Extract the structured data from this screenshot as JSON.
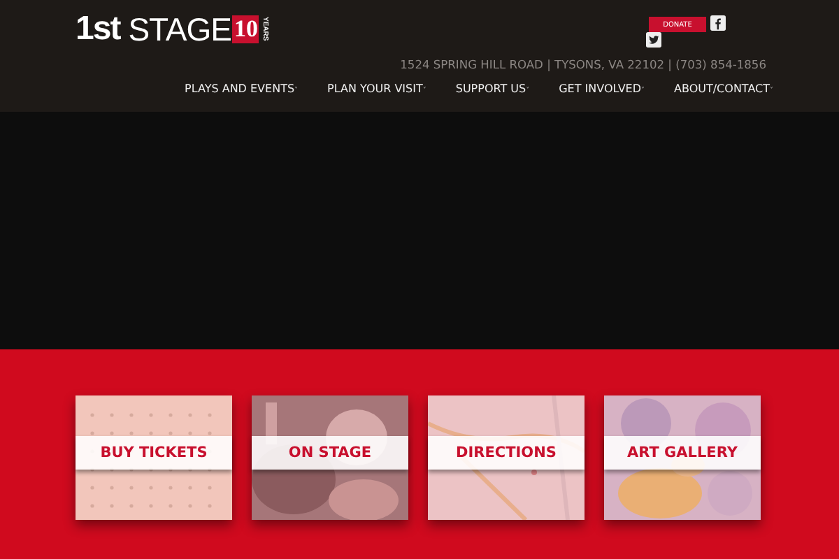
{
  "logo": {
    "word_1": "1st",
    "word_2": "STAGE",
    "badge_number": "10",
    "badge_caption": "YEARS"
  },
  "donate_button": "DONATE",
  "address": "1524 SPRING HILL ROAD | TYSONS, VA 22102 | (703) 854-1856",
  "nav": [
    {
      "label": "PLAYS AND EVENTS",
      "caret": "˅"
    },
    {
      "label": "PLAN YOUR VISIT",
      "caret": "˅"
    },
    {
      "label": "SUPPORT US",
      "caret": "˅"
    },
    {
      "label": "GET INVOLVED",
      "caret": "˅"
    },
    {
      "label": "ABOUT/CONTACT",
      "caret": "˅"
    }
  ],
  "tiles": [
    {
      "label": "BUY TICKETS",
      "kind": "calendar"
    },
    {
      "label": "ON STAGE"
    },
    {
      "label": "DIRECTIONS",
      "kind": "map"
    },
    {
      "label": "ART GALLERY",
      "kind": "flowers"
    }
  ]
}
